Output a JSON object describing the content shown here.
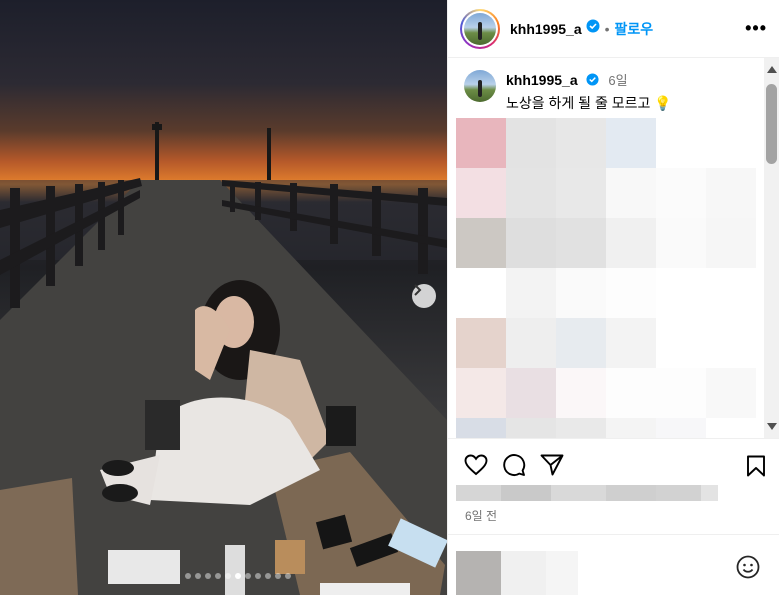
{
  "post": {
    "username": "khh1995_a",
    "follow_label": "팔로우",
    "more_label": "•••",
    "separator": "•"
  },
  "caption": {
    "username": "khh1995_a",
    "time_ago": "6일",
    "text": "노상을 하게 될 줄 모르고 💡"
  },
  "footer": {
    "date_label": "6일 전"
  },
  "carousel": {
    "dot_count": 11,
    "active_index": 5
  },
  "icons": {
    "verified": "verified-badge-icon",
    "like": "heart-icon",
    "comment": "comment-icon",
    "share": "paper-plane-icon",
    "save": "bookmark-icon",
    "next": "chevron-right-icon",
    "emoji": "smiley-icon"
  },
  "colors": {
    "accent": "#0095f6",
    "text": "#000000",
    "muted": "#737373"
  }
}
